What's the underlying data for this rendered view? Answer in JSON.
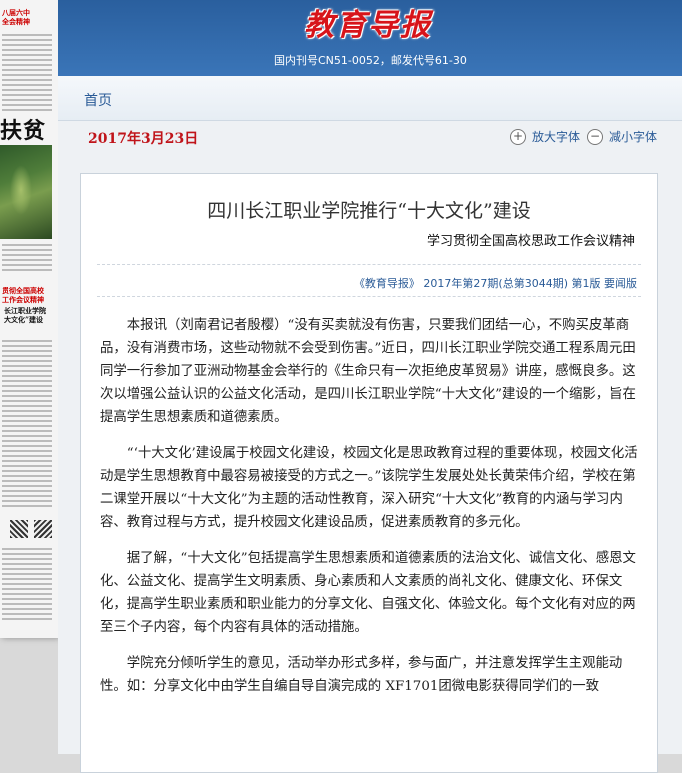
{
  "thumbnail": {
    "head_line1": "八届六中",
    "head_line2": "全会精神",
    "big_text": "扶贫",
    "red_head_line1": "贯彻全国高校",
    "red_head_line2": "工作会议精神",
    "black_head_line1": "长江职业学院",
    "black_head_line2": "大文化”建设"
  },
  "header": {
    "logo": "教育导报",
    "pub_info": "国内刊号CN51-0052，邮发代号61-30"
  },
  "nav": {
    "home": "首页"
  },
  "toolbar": {
    "date": "2017年3月23日",
    "enlarge_label": "放大字体",
    "shrink_label": "减小字体",
    "enlarge_icon": "+",
    "shrink_icon": "−"
  },
  "article": {
    "title": "四川长江职业学院推行“十大文化”建设",
    "subtitle": "学习贯彻全国高校思政工作会议精神",
    "source": "《教育导报》 2017年第27期(总第3044期) 第1版 要闻版",
    "paragraphs": [
      "本报讯（刘南君记者殷樱）“没有买卖就没有伤害，只要我们团结一心，不购买皮革商品，没有消费市场，这些动物就不会受到伤害。”近日，四川长江职业学院交通工程系周元田同学一行参加了亚洲动物基金会举行的《生命只有一次拒绝皮革贸易》讲座，感慨良多。这次以增强公益认识的公益文化活动，是四川长江职业学院“十大文化”建设的一个缩影，旨在提高学生思想素质和道德素质。",
      "“‘十大文化’建设属于校园文化建设，校园文化是思政教育过程的重要体现，校园文化活动是学生思想教育中最容易被接受的方式之一。”该院学生发展处处长黄荣伟介绍，学校在第二课堂开展以“十大文化”为主题的活动性教育，深入研究“十大文化”教育的内涵与学习内容、教育过程与方式，提升校园文化建设品质，促进素质教育的多元化。",
      "据了解，“十大文化”包括提高学生思想素质和道德素质的法治文化、诚信文化、感恩文化、公益文化、提高学生文明素质、身心素质和人文素质的尚礼文化、健康文化、环保文化，提高学生职业素质和职业能力的分享文化、自强文化、体验文化。每个文化有对应的两至三个子内容，每个内容有具体的活动措施。",
      "学院充分倾听学生的意见，活动举办形式多样，参与面广，并注意发挥学生主观能动性。如：分享文化中由学生自编自导自演完成的 XF1701团微电影获得同学们的一致"
    ]
  }
}
